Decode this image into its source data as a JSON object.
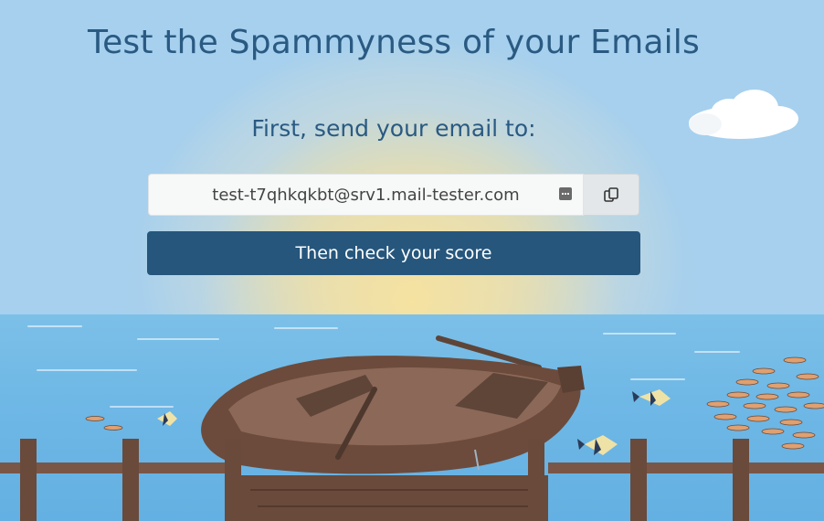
{
  "header": {
    "title": "Test the Spammyness of your Emails"
  },
  "main": {
    "instruction": "First, send your email to:",
    "email_address": "test-t7qhkqkbt@srv1.mail-tester.com",
    "check_button_label": "Then check your score"
  },
  "icons": {
    "copy": "copy-icon",
    "autofill": "password-manager-icon"
  },
  "colors": {
    "title_text": "#2a5a82",
    "button_bg": "#26567c",
    "button_text": "#ffffff",
    "sky": "#a6cff0",
    "sea": "#6fb8e6"
  }
}
